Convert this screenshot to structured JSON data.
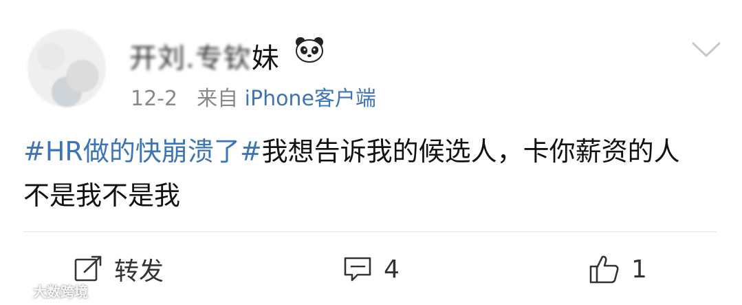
{
  "user": {
    "name_obscured": "",
    "name_visible": "妹",
    "badge": "panda-icon"
  },
  "meta": {
    "date": "12-2",
    "source_prefix": "来自",
    "source_name": "iPhone客户端"
  },
  "post": {
    "hashtag": "#HR做的快崩溃了#",
    "body": "我想告诉我的候选人，卡你薪资的人不是我不是我"
  },
  "actions": {
    "repost_label": "转发",
    "comment_count": "4",
    "like_count": "1"
  },
  "watermark": {
    "text": "大数跨境"
  },
  "colors": {
    "link": "#3c74b5",
    "text": "#111111",
    "muted": "#888888"
  }
}
